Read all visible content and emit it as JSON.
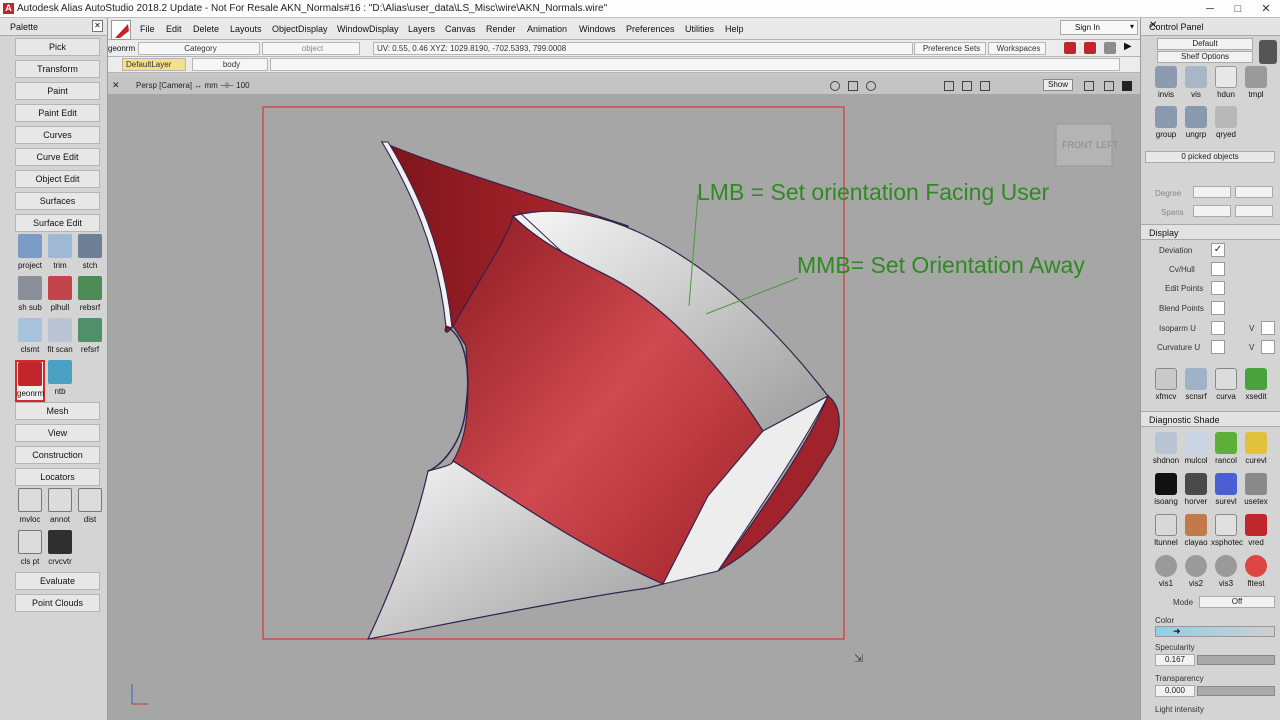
{
  "window": {
    "title": "Autodesk Alias AutoStudio 2018.2 Update - Not For Resale   AKN_Normals#16 : \"D:\\Alias\\user_data\\LS_Misc\\wire\\AKN_Normals.wire\"",
    "minimize": "─",
    "maximize": "□",
    "close": "✕"
  },
  "palette": {
    "title": "Palette",
    "buttons": [
      "Pick",
      "Transform",
      "Paint",
      "Paint Edit",
      "Curves",
      "Curve Edit",
      "Object Edit",
      "Surfaces",
      "Surface Edit"
    ],
    "tools": [
      "project",
      "trim",
      "stch",
      "sh sub",
      "plhull",
      "rebsrf",
      "clsmt",
      "fit scan",
      "refsrf",
      "geonrm",
      "ntb"
    ],
    "buttons2": [
      "Mesh",
      "View",
      "Construction",
      "Locators"
    ],
    "locator_tools": [
      "mvloc",
      "annot",
      "dist",
      "cls pt",
      "crvcvtr"
    ],
    "buttons3": [
      "Evaluate",
      "Point Clouds"
    ]
  },
  "menu": {
    "items": [
      "File",
      "Edit",
      "Delete",
      "Layouts",
      "ObjectDisplay",
      "WindowDisplay",
      "Layers",
      "Canvas",
      "Render",
      "Animation",
      "Windows",
      "Preferences",
      "Utilities",
      "Help"
    ],
    "sign_in": "Sign In"
  },
  "bar2": {
    "tool_name": "geonrm",
    "category": "Category",
    "object": "object",
    "coords": "UV:  0.55,  0.46    XYZ:  1029.8190,  -702.5393,  799.0008",
    "pref_sets": "Preference Sets",
    "workspaces": "Workspaces"
  },
  "bar3": {
    "layer1": "DefaultLayer",
    "layer2": "body"
  },
  "viewport": {
    "label": "Persp [Camera]  ↔ mm   ⊣⊢ 100",
    "show": "Show",
    "cube_front": "FRONT",
    "cube_left": "LEFT",
    "annotation_lmb": "LMB = Set orientation Facing User",
    "annotation_mmb": "MMB= Set Orientation Away"
  },
  "control": {
    "title": "Control Panel",
    "default": "Default",
    "shelf": "Shelf Options",
    "top_tools": [
      "invis",
      "vis",
      "hdun",
      "tmpl",
      "group",
      "ungrp",
      "qryed"
    ],
    "picked": "0 picked objects",
    "degree": "Degree",
    "spans": "Spans",
    "display": "Display",
    "deviation": "Deviation",
    "cvhull": "Cv/Hull",
    "editpoints": "Edit Points",
    "blendpoints": "Blend Points",
    "isoparm": "Isoparm U",
    "curvature": "Curvature U",
    "v": "V",
    "mid_tools": [
      "xfmcv",
      "scnsrf",
      "curva",
      "xsedit"
    ],
    "diag": "Diagnostic Shade",
    "diag_tools": [
      "shdnon",
      "mulcol",
      "rancol",
      "curevl",
      "isoang",
      "horver",
      "surevl",
      "usetex",
      "ltunnel",
      "clayao",
      "xsphotec",
      "vred",
      "vis1",
      "vis2",
      "vis3",
      "fltest"
    ],
    "mode": "Mode",
    "mode_val": "Off",
    "color": "Color",
    "specularity": "Specularity",
    "spec_val": "0.167",
    "transparency": "Transparency",
    "trans_val": "0.000",
    "light": "Light intensity"
  },
  "colors": {
    "red_surface": "#b5252d",
    "annotation": "#2f8a22"
  }
}
